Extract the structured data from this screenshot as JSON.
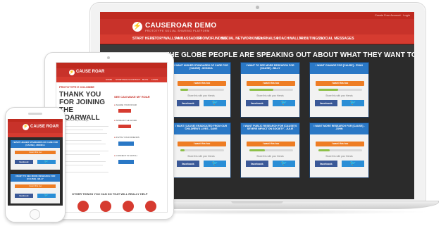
{
  "laptop": {
    "brand": "CAUSEROAR DEMO",
    "tagline": "PROTOTYPE SOCIAL SHARING PLATFORM",
    "top_links": "Create Free Account  ·  Login",
    "nav": [
      "START HERE",
      "STORYWALLS ▾",
      "AMBASSADOR",
      "CROWDFUNDING",
      "SOCIAL NETWORKING ▾",
      "JOURNALS ▾",
      "COACHWALL ▾",
      "TRIBUTINGS ▾",
      "SOCIAL MESSAGES"
    ],
    "headline": "THE GLOBE PEOPLE ARE SPEAKING OUT ABOUT WHAT THEY WANT TO SEE CHANGED.",
    "cards": [
      {
        "title": "I WANT HIGHER STANDARDS OF CARE FOR [CAUSE] - MONICA",
        "cta": "I want this too",
        "progress": 0.18,
        "share": "Share this with your friends",
        "fb": "facebook"
      },
      {
        "title": "I WANT TO SEE MORE RESEARCH FOR [CAUSE] - BILLY",
        "cta": "I want this too",
        "progress": 0.55,
        "share": "Share this with your friends",
        "fb": "facebook"
      },
      {
        "title": "I WANT CHANGE FOR [CAUSE] - RYAN",
        "cta": "I want this too",
        "progress": 0.45,
        "share": "Share this with your friends",
        "fb": "facebook"
      },
      {
        "title": "I WANT [CAUSE] ERADICATED FROM OUR CHILDREN'S LIVES - DAVE",
        "cta": "I want this too",
        "progress": 0.1,
        "share": "Share this with your friends",
        "fb": "facebook"
      },
      {
        "title": "I WANT PUBLIC RESEARCH FOR [CAUSE]'S SEVERE IMPACT ON SOCIETY - JULIE",
        "cta": "I want this too",
        "progress": 0.35,
        "share": "Share this with your friends",
        "fb": "facebook"
      },
      {
        "title": "I WANT MORE RESEARCH FOR [CAUSE] - JOHN",
        "cta": "I want this too",
        "progress": 0.25,
        "share": "Share this with your friends",
        "fb": "facebook"
      }
    ],
    "twitter_glyph": "🐦"
  },
  "tablet": {
    "brand": "CAUSE ROAR",
    "nav": [
      "HOME",
      "STORYWALLS",
      "CONTACT",
      "BLOG",
      "LOGIN"
    ],
    "section_label": "PROTOTYPE E COLOMBE",
    "thanks": "THANK YOU FOR JOINING THE ROARWALL",
    "intro": "This is your first step to change.",
    "right_title": "SEE CAN MAKE MY ROAR",
    "steps": [
      "SHARE YOUR ROAR",
      "SPREAD THE WORD",
      "INVITE YOUR FRIENDS",
      "CONNECT IN MATCH"
    ],
    "other": "OTHER THINGS YOU CAN DO THAT WILL REALLY HELP"
  },
  "phone": {
    "brand": "CAUSE ROAR",
    "cards": [
      {
        "title": "I WANT HIGHER STANDARDS OF CARE FOR [CAUSE] - MONICA",
        "cta": "I want this too",
        "fb": "facebook"
      },
      {
        "title": "I WANT TO SEE MORE RESEARCH FOR [CAUSE] - BILLY",
        "cta": "I want this too",
        "fb": "facebook"
      }
    ]
  }
}
